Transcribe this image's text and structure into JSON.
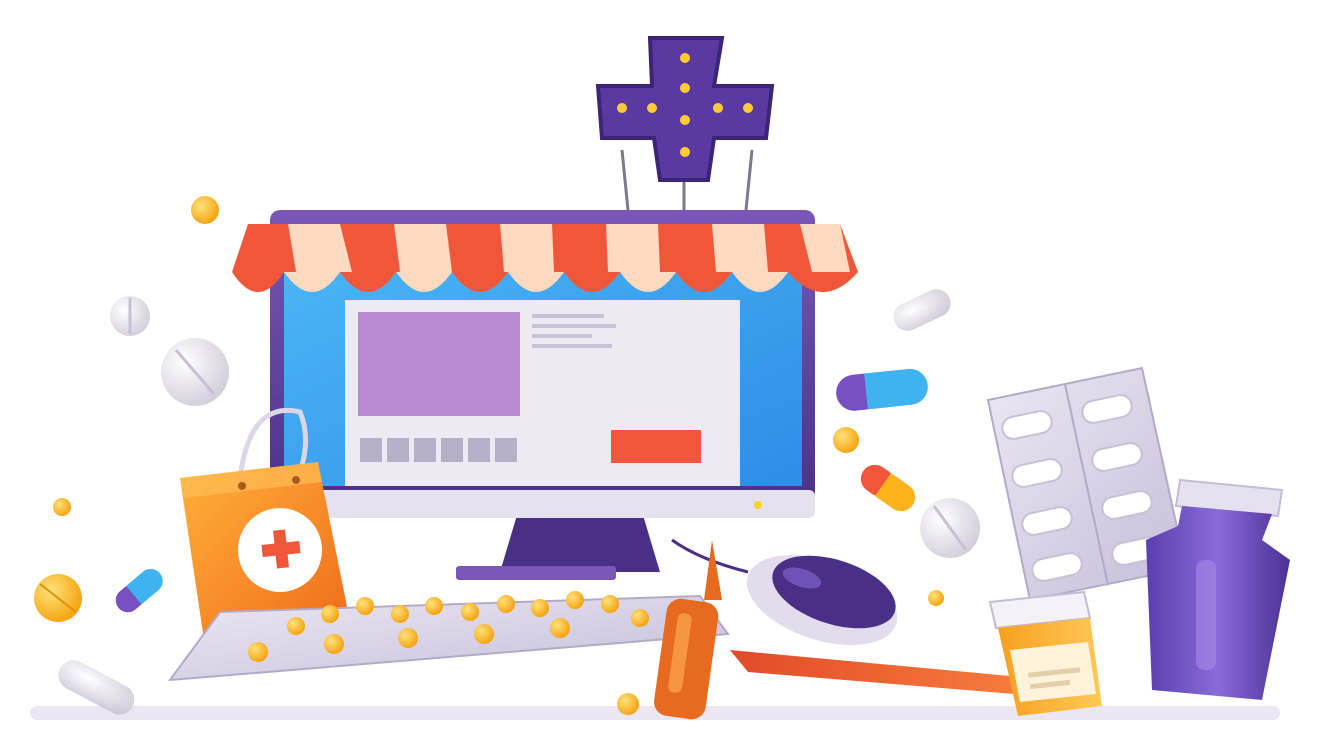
{
  "scene": {
    "kind": "illustration",
    "colors": {
      "background": "#ffffff",
      "monitor_frame": "#6b45a8",
      "monitor_dark": "#2e1f5a",
      "screen_blue": "#3aa8f0",
      "screen_page": "#eeeaf4",
      "awning_red": "#f0573a",
      "awning_cream": "#fdd9c0",
      "cross_purple": "#5a3aa0",
      "cross_lights": "#ffcc33",
      "bag_orange": "#f7891f",
      "blister_silver": "#d9d4e6",
      "pill_yellow": "#ffb21a",
      "bottle_purple": "#7b5cc6",
      "ampoule_orange": "#e86a1e",
      "shadow": "#e7e1ef"
    },
    "icons": [
      "pharmacy-cross-icon",
      "shopping-bag-icon",
      "mouse-icon",
      "keyboard-blister-icon",
      "pill-bottle-icon",
      "ampoule-icon",
      "capsule-icon",
      "tablet-icon"
    ]
  }
}
